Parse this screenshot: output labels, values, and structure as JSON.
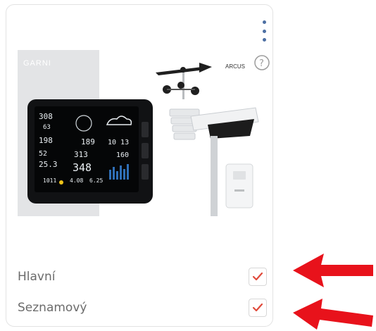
{
  "card": {
    "menu_icon": "kebab-vertical-icon",
    "image": {
      "brand_left": "GARNI",
      "brand_right": "ARCUS",
      "help_icon": "question-circle-icon",
      "display_readings": [
        "308",
        "63",
        "198",
        "52",
        "25.3",
        "189",
        "10 13",
        "313",
        "160",
        "348",
        "1011",
        "4.08",
        "6.25"
      ]
    },
    "options": [
      {
        "label": "Hlavní",
        "checked": true
      },
      {
        "label": "Seznamový",
        "checked": true
      }
    ]
  },
  "colors": {
    "check": "#e04a3b",
    "arrow": "#e8121b",
    "kebab": "#4d6fa3"
  }
}
